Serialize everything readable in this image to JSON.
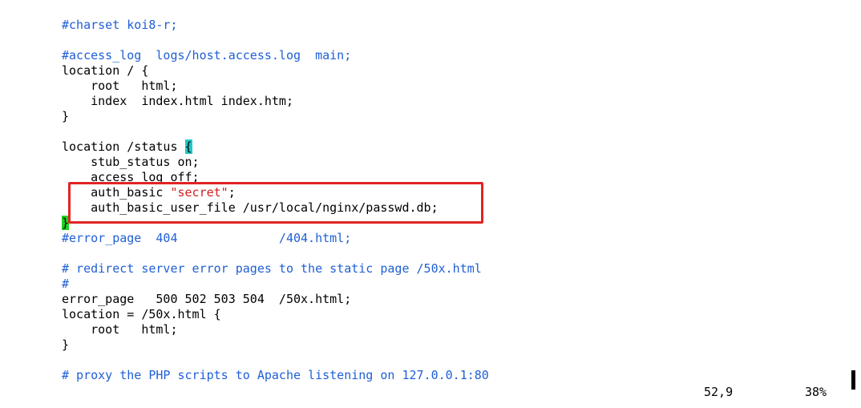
{
  "editor": {
    "lines": [
      {
        "text": "#charset koi8-r;",
        "style": "comment"
      },
      {
        "text": "",
        "style": "normal"
      },
      {
        "text": "#access_log  logs/host.access.log  main;",
        "style": "comment"
      },
      {
        "text": "location / {",
        "style": "normal"
      },
      {
        "text": "    root   html;",
        "style": "normal"
      },
      {
        "text": "    index  index.html index.htm;",
        "style": "normal"
      },
      {
        "text": "}",
        "style": "normal"
      },
      {
        "text": "",
        "style": "normal"
      },
      {
        "parts": [
          {
            "text": "location /status ",
            "style": "normal"
          },
          {
            "text": "{",
            "style": "hl-cyan"
          }
        ]
      },
      {
        "text": "    stub_status on;",
        "style": "normal"
      },
      {
        "text": "    access_log off;",
        "style": "normal"
      },
      {
        "parts": [
          {
            "text": "    auth_basic ",
            "style": "normal"
          },
          {
            "text": "\"secret\"",
            "style": "string"
          },
          {
            "text": ";",
            "style": "normal"
          }
        ]
      },
      {
        "text": "    auth_basic_user_file /usr/local/nginx/passwd.db;",
        "style": "normal"
      },
      {
        "parts": [
          {
            "text": "}",
            "style": "hl-green"
          }
        ]
      },
      {
        "text": "#error_page  404              /404.html;",
        "style": "comment"
      },
      {
        "text": "",
        "style": "normal"
      },
      {
        "text": "# redirect server error pages to the static page /50x.html",
        "style": "comment"
      },
      {
        "text": "#",
        "style": "comment"
      },
      {
        "text": "error_page   500 502 503 504  /50x.html;",
        "style": "normal"
      },
      {
        "text": "location = /50x.html {",
        "style": "normal"
      },
      {
        "text": "    root   html;",
        "style": "normal"
      },
      {
        "text": "}",
        "style": "normal"
      },
      {
        "text": "",
        "style": "normal"
      },
      {
        "text": "# proxy the PHP scripts to Apache listening on 127.0.0.1:80",
        "style": "comment"
      }
    ]
  },
  "status": {
    "cursor_position": "52,9",
    "scroll_percent": "38%"
  },
  "colors": {
    "comment": "#1f5fd6",
    "string": "#d02020",
    "bracket_match_cyan": "#1ec8c8",
    "bracket_match_green": "#22d022",
    "annotation_border": "#e02424"
  }
}
